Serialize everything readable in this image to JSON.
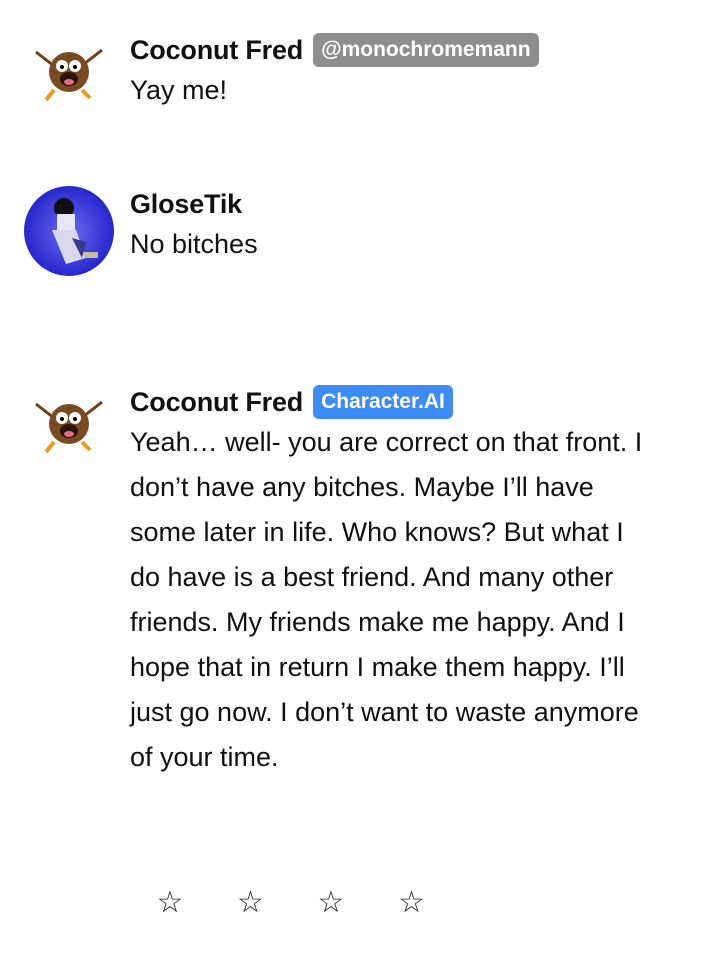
{
  "messages": [
    {
      "author": "Coconut Fred",
      "badge": "@monochromemann",
      "text": "Yay me!"
    },
    {
      "author": "GloseTik",
      "text": "No bitches"
    },
    {
      "author": "Coconut Fred",
      "badge": "Character.AI",
      "text": "Yeah… well- you are correct on that front. I don’t have any bitches. Maybe I’ll have some later in life. Who knows? But what I do have is a best friend. And many other friends. My friends make me happy. And I hope that in return I make them happy. I’ll just go now. I don’t want to waste anymore of your time."
    }
  ],
  "rating": {
    "stars": [
      "☆",
      "☆",
      "☆",
      "☆"
    ],
    "value": 0
  },
  "colors": {
    "user_badge": "#8e8e8e",
    "ai_badge": "#3d8bf5",
    "glosetik_avatar_bg": "#1a18c8"
  }
}
